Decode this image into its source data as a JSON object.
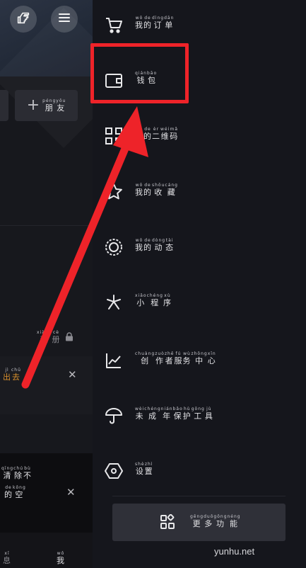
{
  "colors": {
    "accent_red": "#ee2329",
    "orange": "#d9902d",
    "drawer_bg": "#15161c"
  },
  "left_page": {
    "hand_icon": "pointing-hand-icon",
    "menu_icon": "hamburger-menu-icon",
    "add_friend": {
      "pinyin": [
        "péng",
        "yǒu"
      ],
      "hanzi": [
        "朋",
        "友"
      ]
    },
    "private_record": {
      "pinyin": [
        "xiàng",
        "cè"
      ],
      "hanzi": [
        "私",
        "册"
      ]
    },
    "orange_tip": {
      "pinyin": [
        "jì",
        "chū"
      ],
      "hanzi": [
        "出",
        "去"
      ]
    },
    "bottom_tip_line1": {
      "pinyin": [
        "qīng",
        "chú",
        "bù"
      ],
      "hanzi": [
        "清",
        "除",
        "不"
      ]
    },
    "bottom_tip_line2": {
      "pinyin": [
        "de",
        "kōng"
      ],
      "hanzi": [
        "的",
        "空"
      ]
    },
    "tab_left": {
      "pinyin": [
        "xī"
      ],
      "hanzi": [
        "息"
      ]
    },
    "tab_me": {
      "pinyin": [
        "wǒ"
      ],
      "hanzi": [
        "我"
      ]
    }
  },
  "drawer": {
    "items": [
      {
        "icon": "cart-icon",
        "pinyin": [
          "wǒ",
          "de",
          "dìng",
          "dān"
        ],
        "hanzi": [
          "我",
          "的",
          "订",
          "单"
        ]
      },
      {
        "icon": "wallet-icon",
        "pinyin": [
          "qián",
          "bāo"
        ],
        "hanzi": [
          "钱",
          "包"
        ]
      },
      {
        "icon": "qr-code-icon",
        "pinyin": [
          "wǒ",
          "de",
          "èr",
          "wéi",
          "mǎ"
        ],
        "hanzi": [
          "我",
          "的",
          "二",
          "维",
          "码"
        ]
      },
      {
        "icon": "star-icon",
        "pinyin": [
          "wǒ",
          "de",
          "shōu",
          "cáng"
        ],
        "hanzi": [
          "我",
          "的",
          "收",
          "藏"
        ]
      },
      {
        "icon": "moments-icon",
        "pinyin": [
          "wǒ",
          "de",
          "dòng",
          "tài"
        ],
        "hanzi": [
          "我",
          "的",
          "动",
          "态"
        ]
      },
      {
        "icon": "mini-program-icon",
        "pinyin": [
          "xiǎo",
          "chéng",
          "xù"
        ],
        "hanzi": [
          "小",
          "程",
          "序"
        ]
      },
      {
        "icon": "creator-chart-icon",
        "pinyin": [
          "chuàng",
          "zuò",
          "zhě",
          "fú",
          "wù",
          "zhōng",
          "xīn"
        ],
        "hanzi": [
          "创",
          "作",
          "者",
          "服",
          "务",
          "中",
          "心"
        ]
      },
      {
        "icon": "umbrella-icon",
        "pinyin": [
          "wèi",
          "chéng",
          "nián",
          "bǎo",
          "hù",
          "gōng",
          "jù"
        ],
        "hanzi": [
          "未",
          "成",
          "年",
          "保",
          "护",
          "工",
          "具"
        ]
      },
      {
        "icon": "settings-hexagon-icon",
        "pinyin": [
          "shè",
          "zhì"
        ],
        "hanzi": [
          "设",
          "置"
        ]
      }
    ],
    "more_features": {
      "icon": "grid-apps-icon",
      "pinyin": [
        "gēng",
        "duō",
        "gōng",
        "néng"
      ],
      "hanzi": [
        "更",
        "多",
        "功",
        "能"
      ]
    }
  },
  "watermark": "yunhu.net"
}
